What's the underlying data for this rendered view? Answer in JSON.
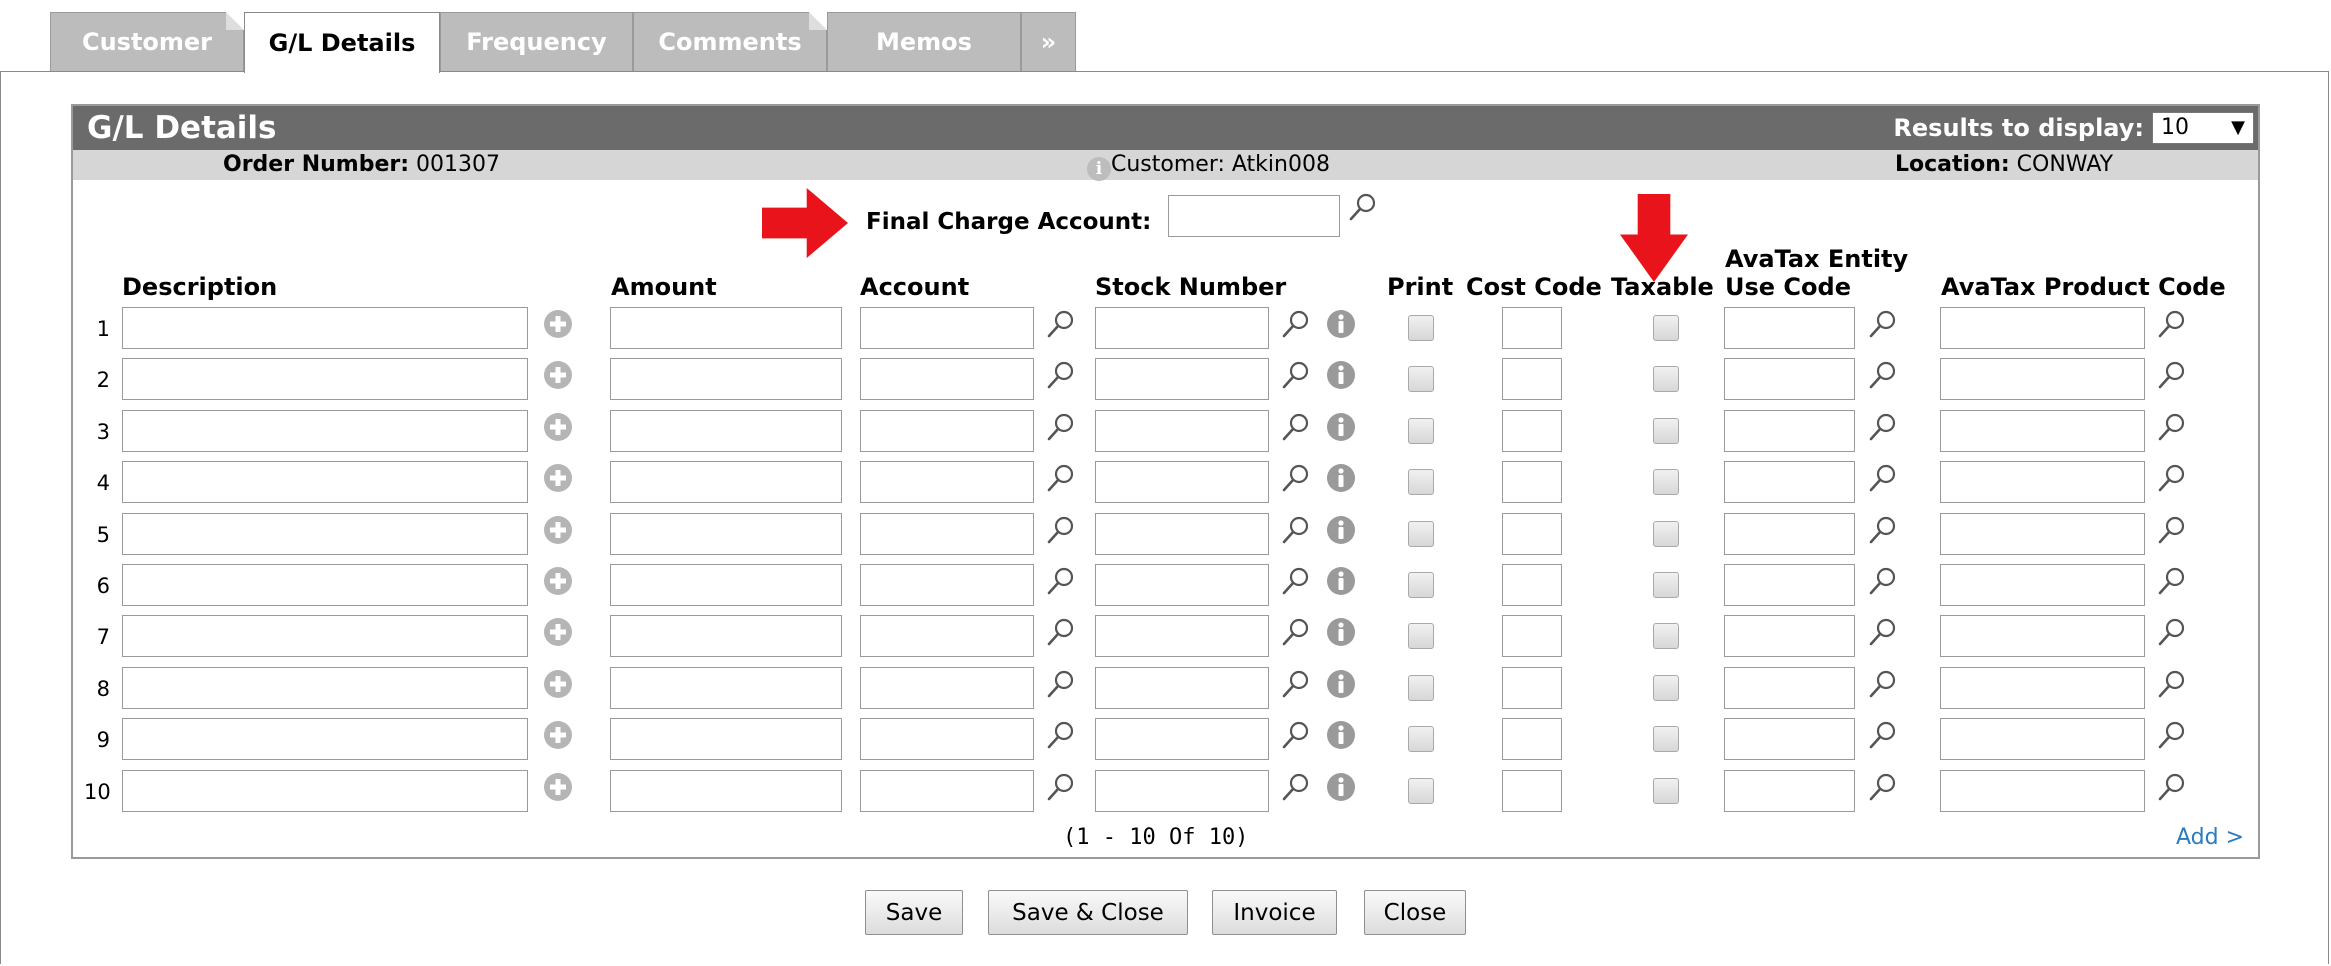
{
  "tabs": [
    {
      "label": "Customer"
    },
    {
      "label": "G/L Details"
    },
    {
      "label": "Frequency"
    },
    {
      "label": "Comments"
    },
    {
      "label": "Memos"
    },
    {
      "label": "»"
    }
  ],
  "panel": {
    "title": "G/L Details",
    "results_label": "Results to display:",
    "results_value": "10"
  },
  "info": {
    "order_label": "Order Number:",
    "order_value": "001307",
    "customer_text": "Customer: Atkin008",
    "location_label": "Location:",
    "location_value": "CONWAY"
  },
  "final_charge": {
    "label": "Final Charge Account:",
    "value": ""
  },
  "columns": {
    "description": "Description",
    "amount": "Amount",
    "account": "Account",
    "stock_number": "Stock Number",
    "print": "Print",
    "cost_code": "Cost Code",
    "taxable": "Taxable",
    "avatax_entity_line1": "AvaTax Entity",
    "avatax_entity_line2": "Use Code",
    "avatax_product": "AvaTax Product Code"
  },
  "rows": [
    {
      "num": "1"
    },
    {
      "num": "2"
    },
    {
      "num": "3"
    },
    {
      "num": "4"
    },
    {
      "num": "5"
    },
    {
      "num": "6"
    },
    {
      "num": "7"
    },
    {
      "num": "8"
    },
    {
      "num": "9"
    },
    {
      "num": "10"
    }
  ],
  "pager": "(1 - 10 Of 10)",
  "add_link": "Add >",
  "buttons": {
    "save": "Save",
    "save_close": "Save & Close",
    "invoice": "Invoice",
    "close": "Close"
  },
  "colors": {
    "header_bg": "#6b6b6b",
    "info_bg": "#d6d6d6",
    "tab_inactive": "#bcbcbc",
    "arrow_red": "#e8131b",
    "link_blue": "#2a7bbf"
  }
}
